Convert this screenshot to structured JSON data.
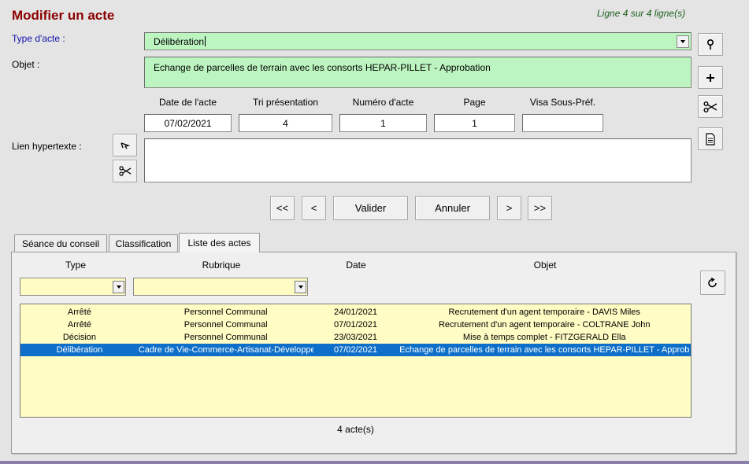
{
  "header": {
    "title": "Modifier un acte",
    "row_info": "Ligne 4 sur 4 ligne(s)"
  },
  "form": {
    "type_label": "Type d'acte :",
    "type_value": "Délibération",
    "objet_label": "Objet :",
    "objet_value": "Echange de parcelles de terrain avec les consorts HEPAR-PILLET - Approbation",
    "columns": [
      "Date de l'acte",
      "Tri présentation",
      "Numéro d'acte",
      "Page",
      "Visa Sous-Préf."
    ],
    "values": [
      "07/02/2021",
      "4",
      "1",
      "1",
      ""
    ],
    "lien_label": "Lien hypertexte :",
    "lien_value": ""
  },
  "nav": {
    "first": "<<",
    "prev": "<",
    "validate": "Valider",
    "cancel": "Annuler",
    "next": ">",
    "last": ">>"
  },
  "tabs": [
    "Séance du conseil",
    "Classification",
    "Liste des actes"
  ],
  "list": {
    "headers": [
      "Type",
      "Rubrique",
      "Date",
      "Objet"
    ],
    "rows": [
      [
        "Arrêté",
        "Personnel Communal",
        "24/01/2021",
        "Recrutement d'un agent temporaire - DAVIS Miles"
      ],
      [
        "Arrêté",
        "Personnel Communal",
        "07/01/2021",
        "Recrutement d'un agent temporaire - COLTRANE John"
      ],
      [
        "Décision",
        "Personnel Communal",
        "23/03/2021",
        "Mise à temps complet - FITZGERALD Ella"
      ],
      [
        "Délibération",
        "Cadre de Vie-Commerce-Artisanat-Développer",
        "07/02/2021",
        "Echange de parcelles de terrain avec les consorts HEPAR-PILLET - Approb"
      ]
    ],
    "selected_index": 3,
    "count": "4 acte(s)"
  },
  "icons": {
    "side": [
      "pin-icon",
      "plus-icon",
      "scissors-icon",
      "document-icon"
    ],
    "link": [
      "link-icon",
      "scissors-icon"
    ],
    "refresh": "refresh-icon"
  },
  "colors": {
    "title": "#8b0000",
    "green_field": "#bdf5c0",
    "yellow_field": "#fffcc4",
    "selection": "#0d6fc9"
  }
}
